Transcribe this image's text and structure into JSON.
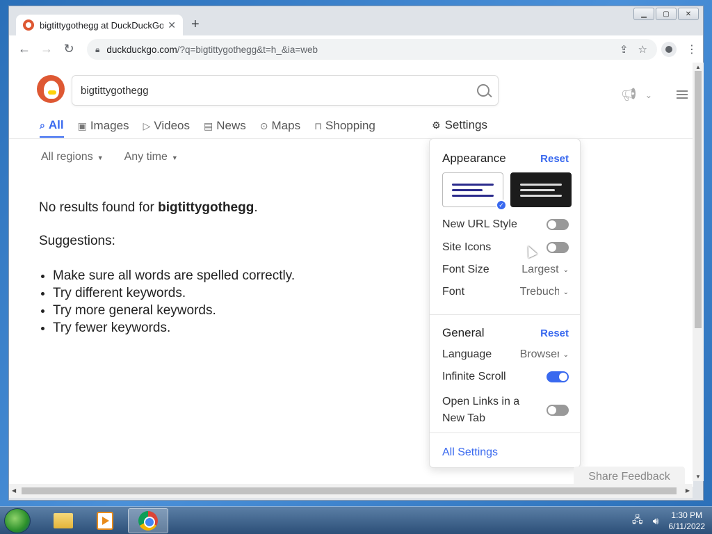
{
  "browser": {
    "tab_title": "bigtittygothegg at DuckDuckGo",
    "new_tab_symbol": "+",
    "url_host": "duckduckgo.com",
    "url_rest": "/?q=bigtittygothegg&t=h_&ia=web"
  },
  "search": {
    "query": "bigtittygothegg"
  },
  "nav": {
    "tabs": [
      {
        "label": "All",
        "icon": "search-icon"
      },
      {
        "label": "Images",
        "icon": "image-icon"
      },
      {
        "label": "Videos",
        "icon": "play-icon"
      },
      {
        "label": "News",
        "icon": "newspaper-icon"
      },
      {
        "label": "Maps",
        "icon": "map-pin-icon"
      },
      {
        "label": "Shopping",
        "icon": "bag-icon"
      }
    ],
    "settings_label": "Settings"
  },
  "filters": {
    "region": "All regions",
    "time": "Any time"
  },
  "results": {
    "no_results_prefix": "No results found for ",
    "no_results_query": "bigtittygothegg",
    "no_results_suffix": ".",
    "suggestions_heading": "Suggestions:",
    "suggestions": [
      "Make sure all words are spelled correctly.",
      "Try different keywords.",
      "Try more general keywords.",
      "Try fewer keywords."
    ]
  },
  "settings_panel": {
    "appearance_title": "Appearance",
    "appearance_reset": "Reset",
    "new_url_style": "New URL Style",
    "site_icons": "Site Icons",
    "font_size_label": "Font Size",
    "font_size_value": "Largest",
    "font_label": "Font",
    "font_value": "Trebuchet",
    "general_title": "General",
    "general_reset": "Reset",
    "language_label": "Language",
    "language_value": "Browser",
    "infinite_scroll": "Infinite Scroll",
    "open_links_line1": "Open Links in a",
    "open_links_line2": "New Tab",
    "all_settings": "All Settings",
    "toggles": {
      "new_url_style": false,
      "site_icons": false,
      "infinite_scroll": true,
      "open_links_new_tab": false
    }
  },
  "share_feedback": "Share Feedback",
  "taskbar": {
    "time": "1:30 PM",
    "date": "6/11/2022"
  },
  "colors": {
    "accent": "#3969ef",
    "ddg_orange": "#de5833"
  }
}
